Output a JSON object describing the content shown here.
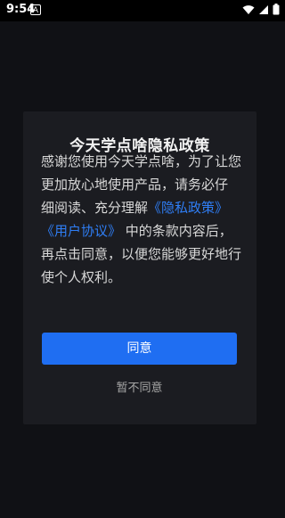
{
  "status_bar": {
    "time": "9:54",
    "notification_icon": "A"
  },
  "dialog": {
    "title": "今天学点啥隐私政策",
    "body": {
      "line1": "感谢您使用今天学点啥，为了让您",
      "line2": "更加放心地使用产品，请务必仔",
      "line3_text": "细阅读、充分理解",
      "privacy_link": "《隐私政策》",
      "user_agreement_link": "《用户协议》",
      "line4_text": "中的条款内容后，",
      "line5": "再点击同意，以便您能够更好地行",
      "line6": "使个人权利。"
    },
    "agree_label": "同意",
    "disagree_label": "暂不同意"
  },
  "colors": {
    "accent": "#1f6ef2",
    "link": "#2f7ef5",
    "dialog_bg": "#1b1c21",
    "screen_bg": "#101115"
  }
}
